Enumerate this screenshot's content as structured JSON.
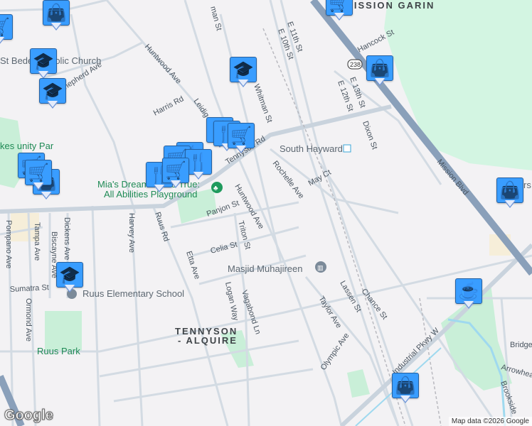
{
  "map": {
    "streets": [
      "Huntwood Ave",
      "Huntwood Ave",
      "Harris Rd",
      "Leidig",
      "Whitman St",
      "Tennyson Rd",
      "Shepherd Ave",
      "Panjon St",
      "Triton St",
      "Celia St",
      "Etta Ave",
      "Ruus Rd",
      "Harvey Ave",
      "Logan Way",
      "Vagabond Ln",
      "Dickens Ave",
      "Tampa Ave",
      "Biscayne Ave",
      "Pompano Ave",
      "Ormond Ave",
      "Sumatra St",
      "E 11th St",
      "E 10th St",
      "Hancock St",
      "E 13th St",
      "E 12th St",
      "Dixon St",
      "Mission Blvd",
      "Rochelle Ave",
      "May Ct",
      "Lassen St",
      "Chance St",
      "Taylor Ave",
      "Olympic Ave",
      "Industrial Pkwy W",
      "Bridge",
      "Arrowhead Way",
      "Brookside",
      "man St"
    ],
    "pois": {
      "church": "St Bede Catholic Church",
      "playground_line1": "Mia's Dream Come True:",
      "playground_line2": "All Abilities Playground",
      "station": "South Hayward",
      "mosque": "Masjid Muhajireen",
      "school": "Ruus Elementary School",
      "park": "Ruus Park",
      "park_left_partial": "kes unity Par",
      "mission_partial": "MISSION GARIN",
      "right_partial": "rs"
    },
    "neighborhood": {
      "line1": "TENNYSON",
      "line2": "- ALQUIRE"
    },
    "highway_shield": "238",
    "markers": [
      {
        "icon": "graduation-cap"
      },
      {
        "icon": "graduation-cap"
      },
      {
        "icon": "graduation-cap"
      },
      {
        "icon": "graduation-cap"
      },
      {
        "icon": "shopping-bag"
      },
      {
        "icon": "shopping-bag"
      },
      {
        "icon": "shopping-bag"
      },
      {
        "icon": "shopping-bag"
      },
      {
        "icon": "coffee-cup"
      },
      {
        "icon": "shopping-cart"
      },
      {
        "icon": "shopping-cart"
      },
      {
        "icon": "shopping-cart"
      },
      {
        "icon": "restaurant"
      },
      {
        "icon": "restaurant"
      },
      {
        "icon": "shopping-cart"
      },
      {
        "icon": "restaurant"
      },
      {
        "icon": "shopping-cart"
      },
      {
        "icon": "restaurant"
      },
      {
        "icon": "restaurant"
      },
      {
        "icon": "shopping-cart"
      },
      {
        "icon": "shopping-cart"
      },
      {
        "icon": "shopping-bag"
      }
    ],
    "logo": "Google",
    "attribution": "Map data ©2026 Google"
  },
  "colors": {
    "background": "#f3f2f4",
    "road": "#d3dbe3",
    "highway": "#8aa0ba",
    "park": "#c9efd8",
    "water": "#9fd9ef",
    "marker_fill": "#e4ecfb",
    "marker_icon": "#0d4466"
  }
}
